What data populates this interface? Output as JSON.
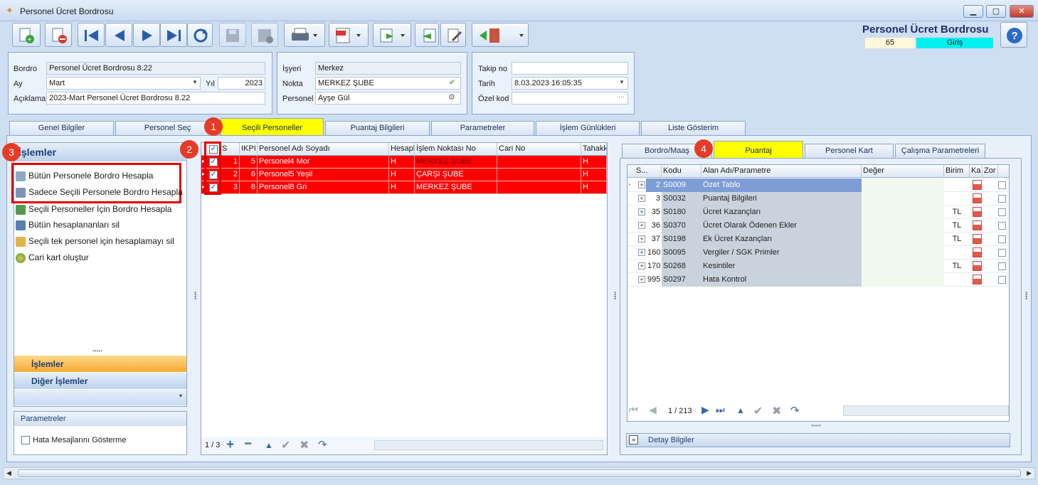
{
  "window": {
    "title": "Personel Ücret Bordrosu"
  },
  "header": {
    "title": "Personel Ücret Bordrosu",
    "count": "65",
    "mode": "Giriş"
  },
  "form": {
    "bordro_label": "Bordro",
    "bordro": "Personel Ücret Bordrosu 8.22",
    "ay_label": "Ay",
    "ay": "Mart",
    "yil_label": "Yıl",
    "yil": "2023",
    "aciklama_label": "Açıklama",
    "aciklama": "2023-Mart Personel Ücret Bordrosu 8.22",
    "isyeri_label": "İşyeri",
    "isyeri": "Merkez",
    "nokta_label": "Nokta",
    "nokta": "MERKEZ ŞUBE",
    "personel_label": "Personel",
    "personel": "Ayşe Gül",
    "takip_label": "Takip no",
    "takip": "",
    "tarih_label": "Tarih",
    "tarih": "8.03.2023 16:05:35",
    "ozel_label": "Özel kod",
    "ozel": ""
  },
  "main_tabs": [
    "Genel Bilgiler",
    "Personel Seç",
    "Seçili Personeller",
    "Puantaj Bilgileri",
    "Parametreler",
    "İşlem Günlükleri",
    "Liste Gösterim"
  ],
  "badges": [
    "1",
    "2",
    "3",
    "4"
  ],
  "left": {
    "title": "İşlemler",
    "items": [
      "Bütün Personele Bordro Hesapla",
      "Sadece Seçili Personele Bordro Hesapla",
      "Seçili Personeller İçin Bordro Hesapla",
      "Bütün hesaplananları sil",
      "Seçili tek personel için hesaplamayı sil",
      "Cari kart oluştur"
    ],
    "nav1": "İşlemler",
    "nav2": "Diğer İşlemler",
    "param_title": "Parametreler",
    "param_check": "Hata Mesajlarını Gösterme"
  },
  "center": {
    "headers": [
      "S",
      "IKPI",
      "Personel Adı Soyadı",
      "Hesapl",
      "İşlem Noktası No",
      "Cari No",
      "Tahakk"
    ],
    "rows": [
      {
        "s": "1",
        "ikp": "5",
        "name": "Personel4 Mor",
        "h": "H",
        "nokta": "MERKEZ ŞUBE",
        "cari": "",
        "t": "H"
      },
      {
        "s": "2",
        "ikp": "6",
        "name": "Personel5 Yeşil",
        "h": "H",
        "nokta": "ÇARŞI ŞUBE",
        "cari": "",
        "t": "H"
      },
      {
        "s": "3",
        "ikp": "8",
        "name": "Personel8 Gri",
        "h": "H",
        "nokta": "MERKEZ ŞUBE",
        "cari": "",
        "t": "H"
      }
    ],
    "pager": "1 / 3"
  },
  "right": {
    "tabs": [
      "Bordro/Maaş",
      "Puantaj",
      "Personel Kart",
      "Çalışma Parametreleri"
    ],
    "headers": [
      "S...",
      "Kodu",
      "Alan Adı/Parametre",
      "Değer",
      "Birim",
      "Ka",
      "Zor"
    ],
    "rows": [
      {
        "s": "2",
        "kod": "S0009",
        "alan": "Özet Tablo",
        "birim": ""
      },
      {
        "s": "3",
        "kod": "S0032",
        "alan": "Puantaj Bilgileri",
        "birim": ""
      },
      {
        "s": "35",
        "kod": "S0180",
        "alan": "Ücret Kazançları",
        "birim": "TL"
      },
      {
        "s": "36",
        "kod": "S0370",
        "alan": "Ücret Olarak Ödenen Ekler",
        "birim": "TL"
      },
      {
        "s": "37",
        "kod": "S0198",
        "alan": "Ek Ücret Kazançları",
        "birim": "TL"
      },
      {
        "s": "160",
        "kod": "S0095",
        "alan": "Vergiler / SGK Primler",
        "birim": ""
      },
      {
        "s": "170",
        "kod": "S0268",
        "alan": "Kesintiler",
        "birim": "TL"
      },
      {
        "s": "995",
        "kod": "S0297",
        "alan": "Hata Kontrol",
        "birim": ""
      }
    ],
    "pager": "1 / 213",
    "detay": "Detay Bilgiler"
  }
}
